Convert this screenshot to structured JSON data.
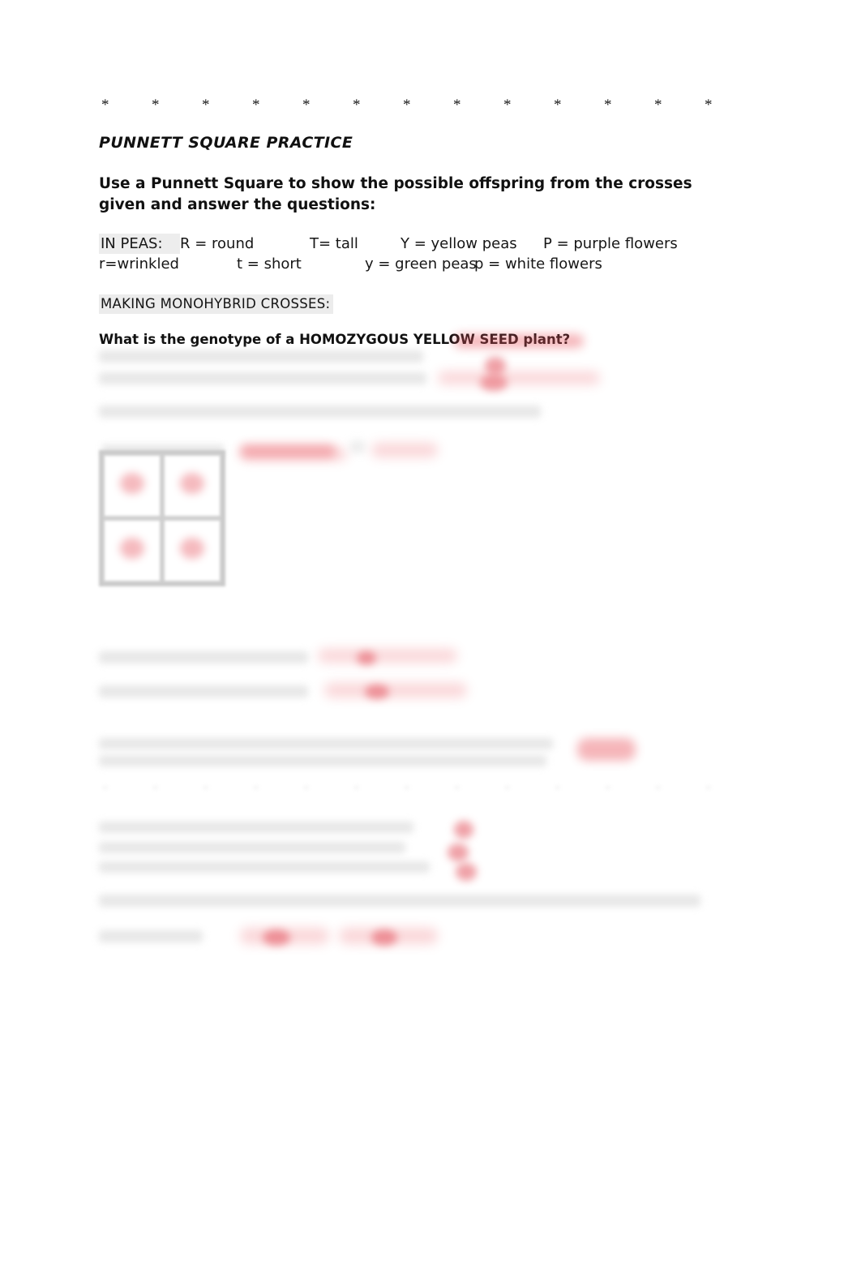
{
  "document": {
    "title": "PUNNETT SQUARE PRACTICE",
    "instructions": "Use a Punnett Square to show the possible offspring from the crosses given and answer the questions:",
    "section_heading": "MAKING MONOHYBRID CROSSES:",
    "question_1": "What is the genotype of a HOMOZYGOUS YELLOW SEED plant?"
  },
  "divider": {
    "symbol": "*",
    "count": 13
  },
  "trait_key": {
    "label": "IN PEAS:",
    "rows": [
      {
        "dominant_round": "R = round",
        "dominant_height": "T= tall",
        "dominant_seed": "Y = yellow peas",
        "dominant_flower": "P = purple flowers"
      },
      {
        "recessive_round": "r=wrinkled",
        "recessive_height": "t = short",
        "recessive_seed": "y = green peas",
        "recessive_flower": "p = white flowers"
      }
    ]
  },
  "punnett_square": {
    "rows": 2,
    "columns": 2,
    "cells": [
      "",
      "",
      "",
      ""
    ]
  },
  "colors": {
    "text": "#111111",
    "highlight": "#ececec",
    "grid_border": "#c9c9c9",
    "handwriting_red": "#e8505a"
  }
}
